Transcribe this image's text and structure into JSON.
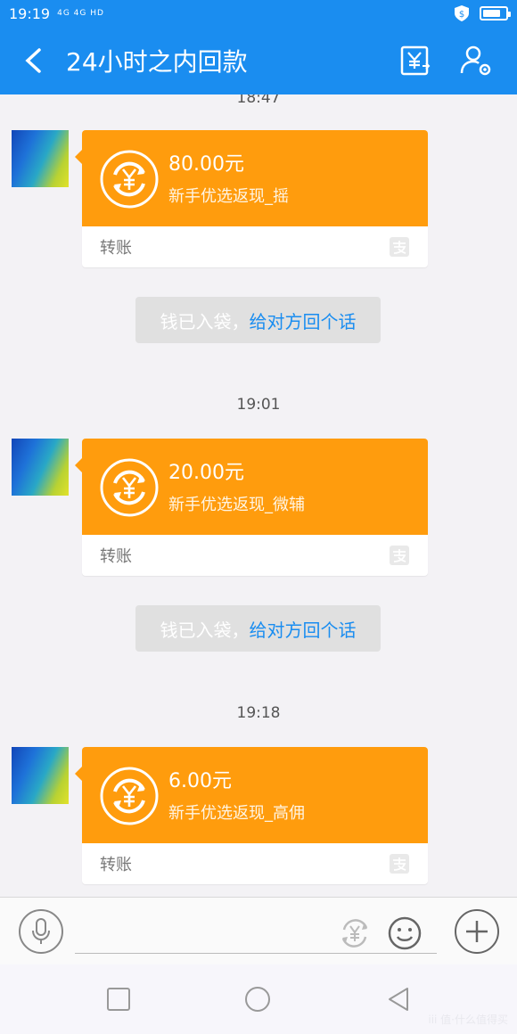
{
  "status": {
    "time": "19:19",
    "network": "4G 4G HD",
    "battery_fraction": 0.8
  },
  "header": {
    "title": "24小时之内回款"
  },
  "chat": {
    "partial_time": "18:47",
    "messages": [
      {
        "time": "",
        "amount": "80.00元",
        "desc": "新手优选返现_摇",
        "type_label": "转账",
        "ack_prefix": "钱已入袋，",
        "ack_link": "给对方回个话"
      },
      {
        "time": "19:01",
        "amount": "20.00元",
        "desc": "新手优选返现_微辅",
        "type_label": "转账",
        "ack_prefix": "钱已入袋，",
        "ack_link": "给对方回个话"
      },
      {
        "time": "19:18",
        "amount": "6.00元",
        "desc": "新手优选返现_高佣",
        "type_label": "转账"
      }
    ]
  },
  "colors": {
    "brand_blue": "#1a8df0",
    "transfer_orange": "#ff9c0d",
    "background": "#f3f2f5"
  },
  "icons": {
    "back": "back-arrow-icon",
    "transfer": "yen-transfer-icon",
    "profile": "user-settings-icon",
    "mic": "microphone-icon",
    "red_packet": "yen-circle-icon",
    "emoji": "smile-icon",
    "plus": "plus-icon"
  },
  "watermark": "iii 值·什么值得买"
}
